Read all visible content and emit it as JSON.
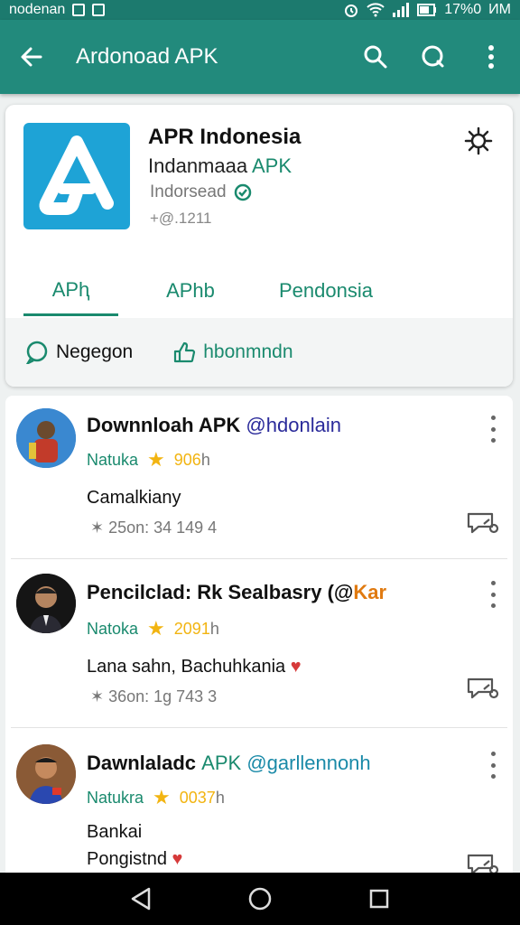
{
  "status": {
    "carrier": "nodenan",
    "battery": "17%0",
    "time": "ИМ"
  },
  "appbar": {
    "title": "Ardonoad APK",
    "back_icon": "arrow-left-icon",
    "search_icon": "search-icon",
    "search2_icon": "search-icon",
    "more_icon": "more-vert-icon"
  },
  "app": {
    "name": "APR Indonesia",
    "subtitle_prefix": "Indanmaaa",
    "subtitle_accent": "APK",
    "developer": "Indorsead",
    "version": "+@.1211",
    "logo_color": "#1ea3d6"
  },
  "tabs": [
    {
      "label": "APⱨ"
    },
    {
      "label": "APhb"
    },
    {
      "label": "Pendonsia"
    }
  ],
  "actions": {
    "left_label": "Negegon",
    "right_label": "hbonmndn"
  },
  "posts": [
    {
      "title": "Downnloah APK",
      "handle": "@hdonlain",
      "handle_color": "#2a2a9a",
      "user": "Natuka",
      "rating": "906",
      "rating_unit": "h",
      "body": "Camalkiany",
      "heart": "",
      "stats": "✶ 25on:  34 149  4"
    },
    {
      "title": "Pencilclad: Rk Sealbasry (@",
      "handle": "Kar",
      "handle_color": "#e07a10",
      "user": "Natoka",
      "rating": "2091",
      "rating_unit": "h",
      "body": "Lana sahn, Bachuhkania",
      "heart": "♥",
      "stats": "✶ 36on:  1g 743  3"
    },
    {
      "title": "Dawnlaladc",
      "title_accent": "APK",
      "handle": "@garllennonh",
      "handle_color": "#1a8aa8",
      "user": "Natukra",
      "rating": "0037",
      "rating_unit": "h",
      "body": "Bankai",
      "body2": "Pongistnd",
      "heart": "♥",
      "stats": ""
    }
  ],
  "navbar": {
    "back_icon": "nav-back-icon",
    "home_icon": "nav-home-icon",
    "recents_icon": "nav-recents-icon"
  }
}
